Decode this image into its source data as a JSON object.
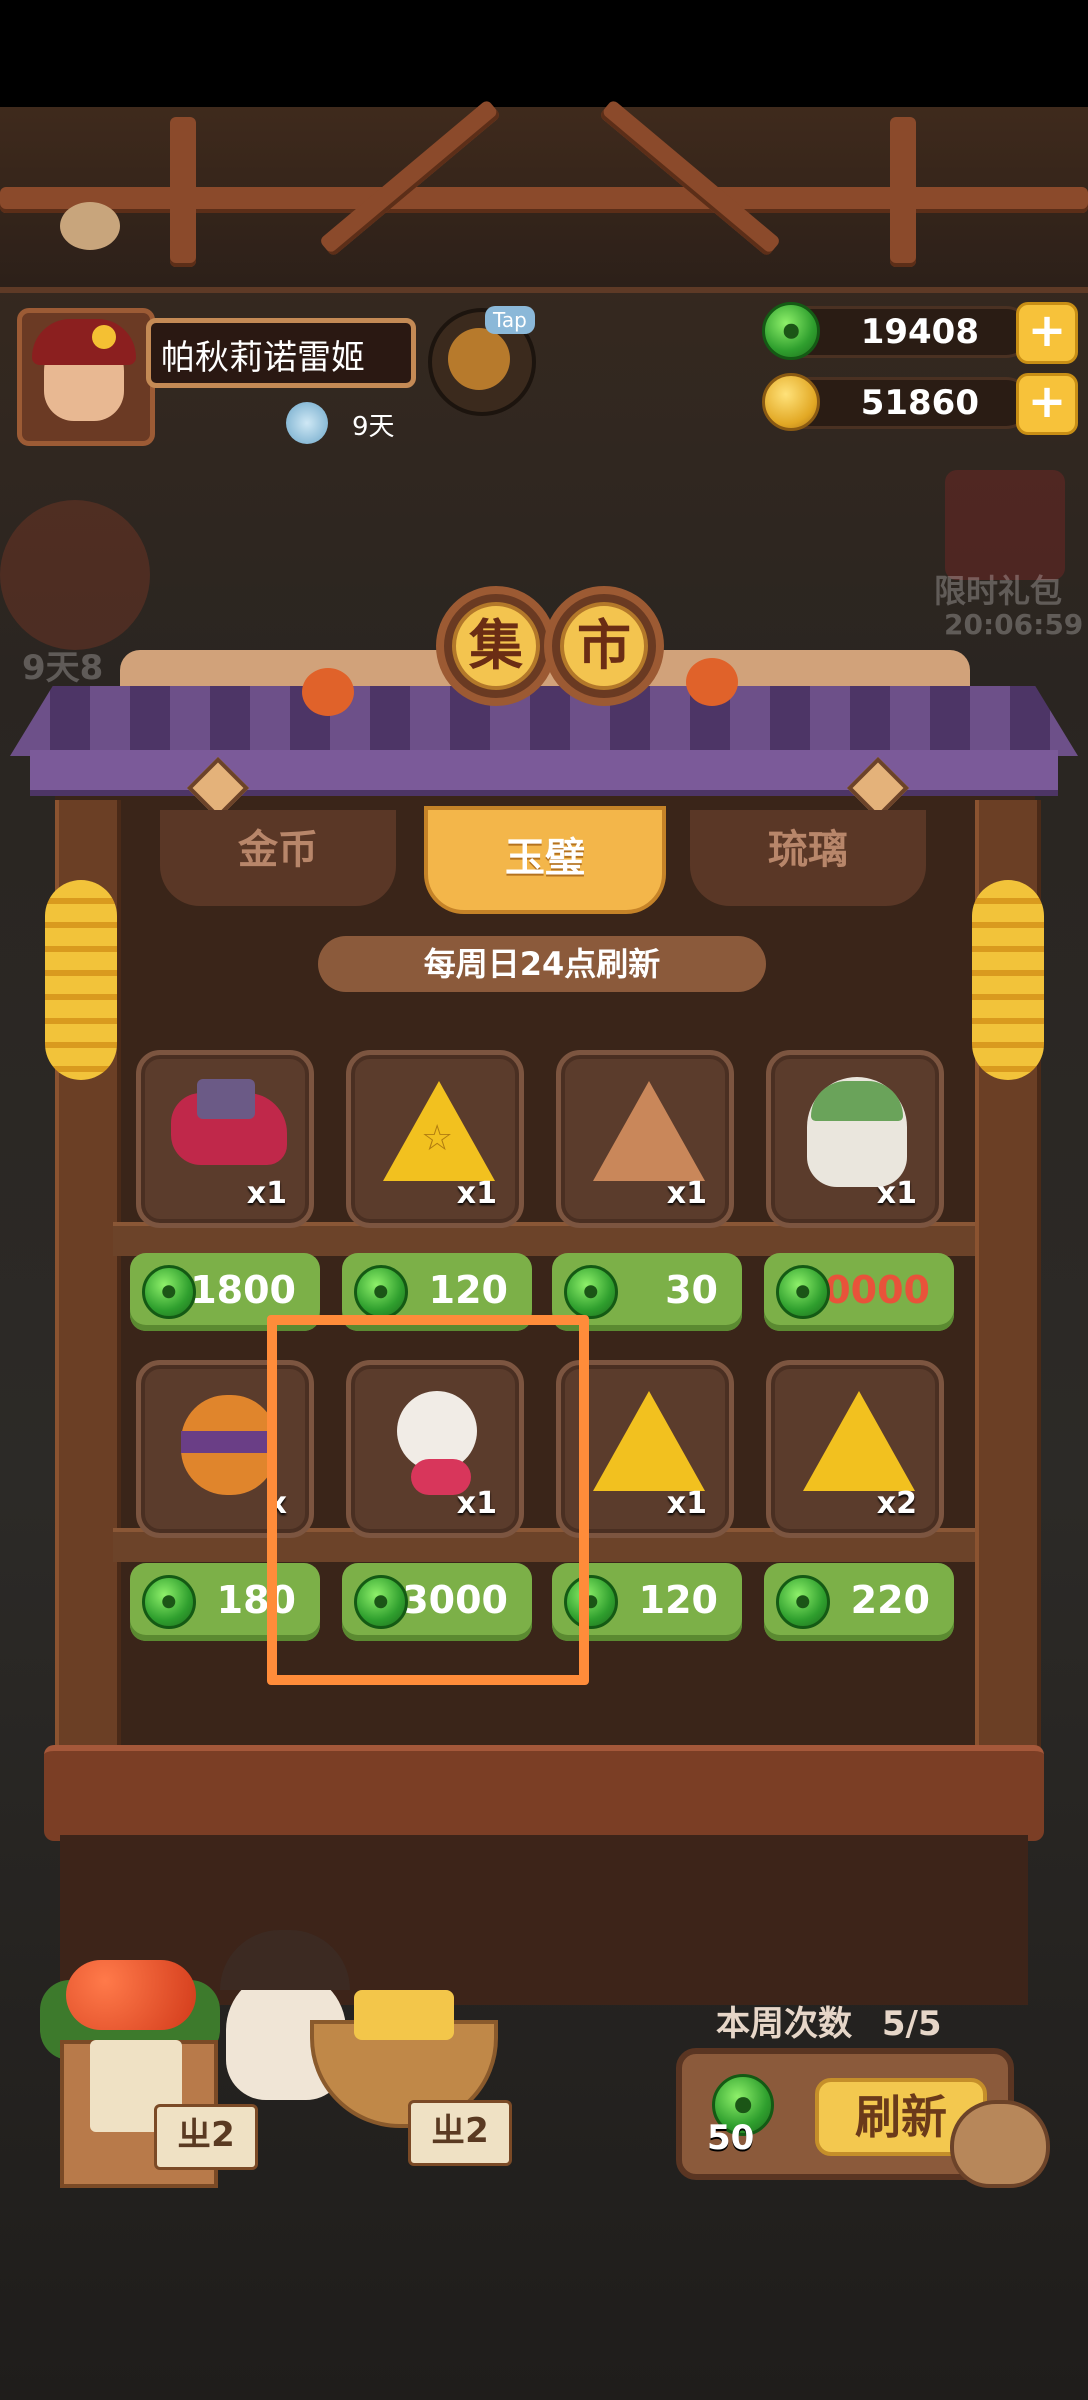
{
  "player": {
    "name": "帕秋莉诺雷姬",
    "days": "9天",
    "tap_label": "Tap"
  },
  "currencies": [
    {
      "name": "jade",
      "value": "19408"
    },
    {
      "name": "coin",
      "value": "51860"
    }
  ],
  "background": {
    "left_event_time": "9天8",
    "right_event_label": "限时礼包",
    "right_event_time": "20:06:59"
  },
  "shop": {
    "title_chars": [
      "集",
      "市"
    ],
    "tabs": [
      {
        "label": "金币",
        "active": false
      },
      {
        "label": "玉璧",
        "active": true
      },
      {
        "label": "琉璃",
        "active": false
      }
    ],
    "refresh_note": "每周日24点刷新",
    "items": [
      {
        "icon": "red-bird-toy",
        "qty": "x1",
        "price": "1800"
      },
      {
        "icon": "yellow-star-badge",
        "qty": "x1",
        "price": "120"
      },
      {
        "icon": "brown-triangle-badge",
        "qty": "x1",
        "price": "30"
      },
      {
        "icon": "green-hair-character",
        "qty": "x1",
        "price": "30000"
      },
      {
        "icon": "orange-pot",
        "qty": "x",
        "price": "180"
      },
      {
        "icon": "white-hair-character",
        "qty": "x1",
        "price": "3000"
      },
      {
        "icon": "yellow-rune-badge",
        "qty": "x1",
        "price": "120"
      },
      {
        "icon": "yellow-rune-badge",
        "qty": "x2",
        "price": "220"
      }
    ]
  },
  "counter": {
    "stall_labels": [
      "ㄓ2",
      "ㄓ2"
    ]
  },
  "refresh": {
    "weekly_label": "本周次数",
    "weekly_count": "5/5",
    "cost": "50",
    "button_label": "刷新"
  },
  "colors": {
    "jade": "#3fae38",
    "gold": "#f3c44f",
    "price_bg": "#7cb048",
    "highlight": "#ff8c3a"
  }
}
